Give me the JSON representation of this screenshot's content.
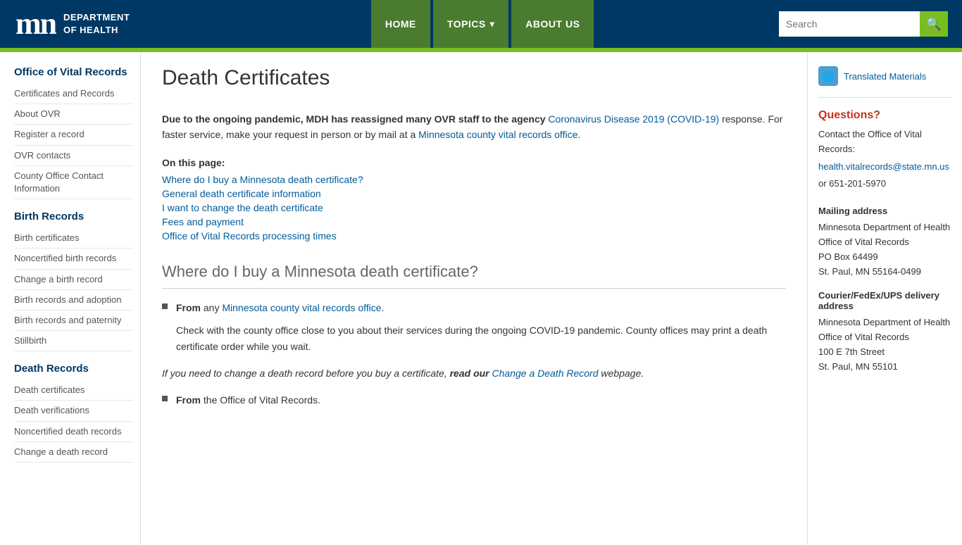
{
  "header": {
    "logo_m": "m",
    "logo_n": "n",
    "dept_line1": "DEPARTMENT",
    "dept_line2": "OF HEALTH",
    "nav": {
      "home": "HOME",
      "topics": "TOPICS",
      "about_us": "ABOUT US"
    },
    "search_placeholder": "Search"
  },
  "sidebar": {
    "section1_title": "Office of Vital Records",
    "section1_items": [
      "Certificates and Records",
      "About OVR",
      "Register a record",
      "OVR contacts",
      "County Office Contact Information"
    ],
    "section2_title": "Birth Records",
    "section2_items": [
      "Birth certificates",
      "Noncertified birth records",
      "Change a birth record",
      "Birth records and adoption",
      "Birth records and paternity",
      "Stillbirth"
    ],
    "section3_title": "Death Records",
    "section3_items": [
      "Death certificates",
      "Death verifications",
      "Noncertified death records",
      "Change a death record"
    ]
  },
  "main": {
    "page_title": "Death Certificates",
    "alert": {
      "text1": "Due to the ongoing pandemic, MDH has reassigned many OVR staff to the agency ",
      "link1_text": "Coronavirus Disease 2019 (COVID-19)",
      "text2": " response. For faster service, make your request in person or by mail at a ",
      "link2_text": "Minnesota county vital records office",
      "text3": "."
    },
    "on_this_page": "On this page:",
    "toc": [
      "Where do I buy a Minnesota death certificate?",
      "General death certificate information",
      "I want to change the death certificate",
      "Fees and payment",
      "Office of Vital Records processing times"
    ],
    "section1_heading": "Where do I buy a Minnesota death certificate?",
    "bullet1_bold": "From",
    "bullet1_link": "Minnesota county vital records office",
    "bullet1_text": ".",
    "bullet1_sub": "Check with the county office close to you about their services during the ongoing COVID-19 pandemic. County offices may print a death certificate order while you wait.",
    "italic_note_text1": "If you need to change a death record before you buy a certificate, ",
    "italic_note_bold": "read our",
    "italic_note_link": "Change a Death Record",
    "italic_note_text2": " webpage.",
    "bullet2_bold": "From",
    "bullet2_text": " the Office of Vital Records."
  },
  "right_sidebar": {
    "translated_label": "Translated Materials",
    "questions_title": "Questions?",
    "questions_text1": "Contact the Office of Vital Records:",
    "email": "health.vitalrecords@state.mn.us",
    "phone": "or 651-201-5970",
    "mailing_title": "Mailing address",
    "mailing_lines": [
      "Minnesota Department of Health",
      "Office of Vital Records",
      "PO Box 64499",
      "St. Paul, MN 55164-0499"
    ],
    "courier_title": "Courier/FedEx/UPS delivery address",
    "courier_lines": [
      "Minnesota Department of Health",
      "Office of Vital Records",
      "100 E 7th Street",
      "St. Paul, MN 55101"
    ]
  }
}
